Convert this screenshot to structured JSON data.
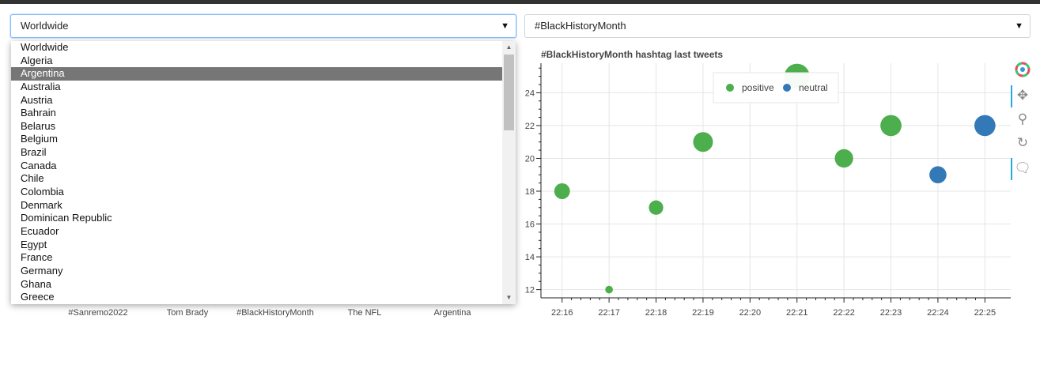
{
  "location_select": {
    "value": "Worldwide",
    "options": [
      "Worldwide",
      "Algeria",
      "Argentina",
      "Australia",
      "Austria",
      "Bahrain",
      "Belarus",
      "Belgium",
      "Brazil",
      "Canada",
      "Chile",
      "Colombia",
      "Denmark",
      "Dominican Republic",
      "Ecuador",
      "Egypt",
      "France",
      "Germany",
      "Ghana",
      "Greece"
    ],
    "highlighted": "Argentina"
  },
  "hashtag_select": {
    "value": "#BlackHistoryMonth"
  },
  "trends_axis_labels": [
    "#Sanremo2022",
    "Tom Brady",
    "#BlackHistoryMonth",
    "The NFL",
    "Argentina"
  ],
  "colors": {
    "positive": "#4cae4c",
    "neutral": "#3379b7"
  },
  "chart_data": {
    "type": "scatter",
    "title": "#BlackHistoryMonth hashtag last tweets",
    "xlabel": "",
    "ylabel": "",
    "x_ticks": [
      "22:16",
      "22:17",
      "22:18",
      "22:19",
      "22:20",
      "22:21",
      "22:22",
      "22:23",
      "22:24",
      "22:25"
    ],
    "y_ticks": [
      12,
      14,
      16,
      18,
      20,
      22,
      24
    ],
    "ylim": [
      11.5,
      25.8
    ],
    "legend_position": "top-center",
    "series": [
      {
        "name": "positive",
        "points": [
          {
            "x": "22:16",
            "y": 18
          },
          {
            "x": "22:17",
            "y": 12
          },
          {
            "x": "22:18",
            "y": 17
          },
          {
            "x": "22:19",
            "y": 21
          },
          {
            "x": "22:21",
            "y": 25
          },
          {
            "x": "22:22",
            "y": 20
          },
          {
            "x": "22:23",
            "y": 22
          }
        ]
      },
      {
        "name": "neutral",
        "points": [
          {
            "x": "22:24",
            "y": 19
          },
          {
            "x": "22:25",
            "y": 22
          }
        ]
      }
    ]
  },
  "toolbar": {
    "tools": [
      "bokeh-logo-icon",
      "pan-icon",
      "box-zoom-icon",
      "reset-icon",
      "hover-icon"
    ]
  }
}
